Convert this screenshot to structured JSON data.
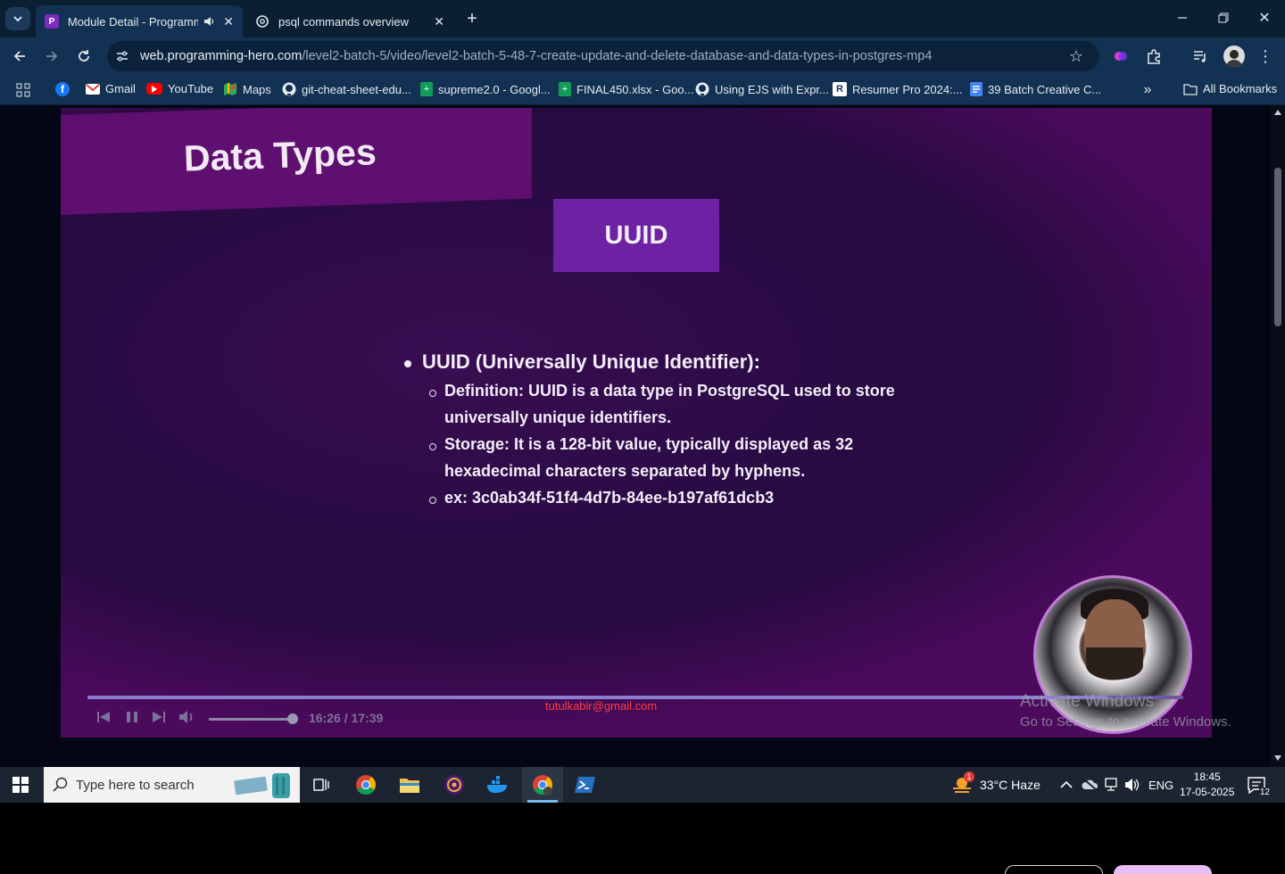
{
  "browser": {
    "tabs": [
      {
        "title": "Module Detail - Programmi",
        "active": true,
        "audio": true
      },
      {
        "title": "psql commands overview",
        "active": false
      }
    ],
    "url_host": "web.programming-hero.com",
    "url_path": "/level2-batch-5/video/level2-batch-5-48-7-create-update-and-delete-database-and-data-types-in-postgres-mp4",
    "bookmarks": [
      "Gmail",
      "YouTube",
      "Maps",
      "git-cheat-sheet-edu...",
      "supreme2.0 - Googl...",
      "FINAL450.xlsx - Goo...",
      "Using EJS with Expr...",
      "Resumer Pro 2024:...",
      "39 Batch Creative C...",
      "All Bookmarks"
    ]
  },
  "slide": {
    "banner": "Data Types",
    "box_label": "UUID",
    "heading": "UUID (Universally Unique Identifier):",
    "points": [
      {
        "lines": [
          "Definition: UUID is a data type in PostgreSQL used to store",
          "universally unique identifiers."
        ]
      },
      {
        "lines": [
          "Storage: It is a 128-bit value, typically displayed as 32",
          "hexadecimal characters separated by hyphens."
        ]
      },
      {
        "lines": [
          "ex: 3c0ab34f-51f4-4d7b-84ee-b197af61dcb3"
        ]
      }
    ]
  },
  "player": {
    "watermark": "tutulkabir@gmail.com",
    "time": "16:26 / 17:39",
    "progress_fraction": 0.9307,
    "volume_fraction": 1.0
  },
  "overlay": {
    "activate_title": "Activate Windows",
    "activate_sub": "Go to Settings to activate Windows."
  },
  "taskbar": {
    "search_placeholder": "Type here to search",
    "weather": "33°C  Haze",
    "lang": "ENG",
    "time": "18:45",
    "date": "17-05-2025",
    "notification_count": "12",
    "weather_badge": "1"
  },
  "colors": {
    "slide_bg": "#2a0b45",
    "banner": "#5e0f70",
    "uuid_box": "#6d22a4",
    "watermark": "#ff3d3d",
    "chrome_frame": "#0b1f33",
    "toolbar": "#133152"
  }
}
